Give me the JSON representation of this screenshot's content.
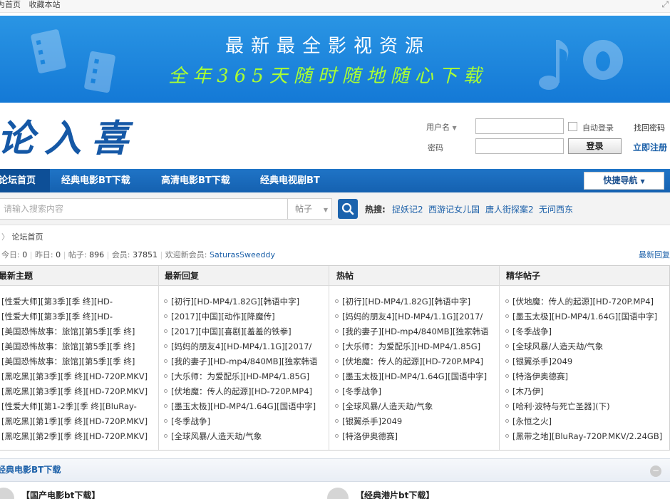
{
  "topbar": {
    "home_link": "为首页",
    "bookmark_link": "收藏本站",
    "resize_icon": "expand-icon"
  },
  "banner": {
    "line1": "最新最全影视资源",
    "line2": "全年365天随时随地随心下载",
    "colors": {
      "bg": "#1a86de",
      "line2": "#aaff33"
    }
  },
  "logo": {
    "text": "论入喜"
  },
  "login": {
    "username_label": "用户名",
    "password_label": "密码",
    "auto_login_label": "自动登录",
    "find_password": "找回密码",
    "login_button": "登录",
    "register_link": "立即注册"
  },
  "nav": {
    "items": [
      "论坛首页",
      "经典电影BT下载",
      "高清电影BT下载",
      "经典电视剧BT"
    ],
    "quick_nav": "快捷导航"
  },
  "search": {
    "placeholder": "请输入搜索内容",
    "type": "帖子",
    "hot_label": "热搜:",
    "hot_terms": [
      "捉妖记2",
      "西游记女儿国",
      "唐人街探案2",
      "无问西东"
    ]
  },
  "breadcrumb": {
    "home": "论坛首页"
  },
  "stats": {
    "today_label": "今日:",
    "today": "0",
    "yesterday_label": "昨日:",
    "yesterday": "0",
    "posts_label": "帖子:",
    "posts": "896",
    "members_label": "会员:",
    "members": "37851",
    "welcome_label": "欢迎新会员:",
    "new_member": "SaturasSweeddy",
    "latest_reply_link": "最新回复"
  },
  "portal": {
    "columns": [
      {
        "title": "最新主题",
        "items": [
          "[性爱大师][第3季][季 终][HD-",
          "[性爱大师][第3季][季 终][HD-",
          "[美国恐怖故事：旅馆][第5季][季 终]",
          "[美国恐怖故事：旅馆][第5季][季 终]",
          "[美国恐怖故事：旅馆][第5季][季 终]",
          "[黑吃黑][第3季][季 终][HD-720P.MKV]",
          "[黑吃黑][第3季][季 终][HD-720P.MKV]",
          "[性爱大师][第1-2季][季 终][BluRay-",
          "[黑吃黑][第1季][季 终][HD-720P.MKV]",
          "[黑吃黑][第2季][季 终][HD-720P.MKV]"
        ]
      },
      {
        "title": "最新回复",
        "items": [
          "[初行][HD-MP4/1.82G][韩语中字]",
          "[2017][中国][动作][降魔传]",
          "[2017][中国][喜剧][羞羞的铁拳]",
          "[妈妈的朋友4][HD-MP4/1.1G][2017/",
          "[我的妻子][HD-mp4/840MB][独家韩语",
          "[大乐师：为爱配乐][HD-MP4/1.85G]",
          "[伏地魔：传人的起源][HD-720P.MP4]",
          "[墨玉太极][HD-MP4/1.64G][国语中字]",
          "[冬季战争]",
          "[全球风暴/人造天劫/气象"
        ]
      },
      {
        "title": "热帖",
        "items": [
          "[初行][HD-MP4/1.82G][韩语中字]",
          "[妈妈的朋友4][HD-MP4/1.1G][2017/",
          "[我的妻子][HD-mp4/840MB][独家韩语",
          "[大乐师：为爱配乐][HD-MP4/1.85G]",
          "[伏地魔：传人的起源][HD-720P.MP4]",
          "[墨玉太极][HD-MP4/1.64G][国语中字]",
          "[冬季战争]",
          "[全球风暴/人造天劫/气象",
          "[银翼杀手]2049",
          "[特洛伊奥德赛]"
        ]
      },
      {
        "title": "精华帖子",
        "items": [
          "[伏地魔：传人的起源][HD-720P.MP4]",
          "[墨玉太极][HD-MP4/1.64G][国语中字]",
          "[冬季战争]",
          "[全球风暴/人造天劫/气象",
          "[银翼杀手]2049",
          "[特洛伊奥德赛]",
          "[木乃伊]",
          "[哈利·波特与死亡圣器](下)",
          "[永恒之火]",
          "[黑带之地][BluRay-720P.MKV/2.24GB]"
        ]
      }
    ]
  },
  "category": {
    "title": "经典电影BT下载",
    "forums": [
      "【国产电影bt下载】",
      "【经典港片bt下载】"
    ]
  }
}
